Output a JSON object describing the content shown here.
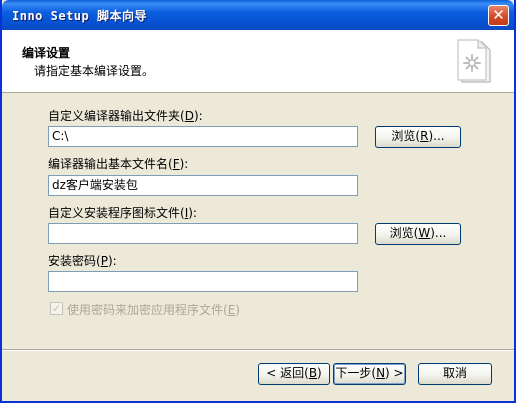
{
  "window": {
    "title": "Inno Setup 脚本向导",
    "close_symbol": "✕"
  },
  "header": {
    "title": "编译设置",
    "subtitle": "请指定基本编译设置。",
    "icon": "document-gear-icon"
  },
  "form": {
    "output_folder": {
      "label": "自定义编译器输出文件夹(",
      "hotkey": "D",
      "label_end": "):",
      "value": "C:\\",
      "browse_label": "浏览(",
      "browse_hotkey": "R",
      "browse_end": ")..."
    },
    "output_basename": {
      "label": "编译器输出基本文件名(",
      "hotkey": "F",
      "label_end": "):",
      "value": "dz客户端安装包"
    },
    "setup_icon": {
      "label": "自定义安装程序图标文件(",
      "hotkey": "I",
      "label_end": "):",
      "value": "",
      "browse_label": "浏览(",
      "browse_hotkey": "W",
      "browse_end": ")..."
    },
    "password": {
      "label": "安装密码(",
      "hotkey": "P",
      "label_end": "):",
      "value": ""
    },
    "encrypt": {
      "label": "使用密码来加密应用程序文件(",
      "hotkey": "E",
      "label_end": ")",
      "checked": true,
      "enabled": false
    }
  },
  "footer": {
    "back_label": "< 返回(",
    "back_hotkey": "B",
    "back_end": ")",
    "next_label": "下一步(",
    "next_hotkey": "N",
    "next_end": ") >",
    "cancel_label": "取消"
  },
  "colors": {
    "titlebar": "#0654d6",
    "face": "#ece9d8",
    "close": "#d44a2a"
  }
}
